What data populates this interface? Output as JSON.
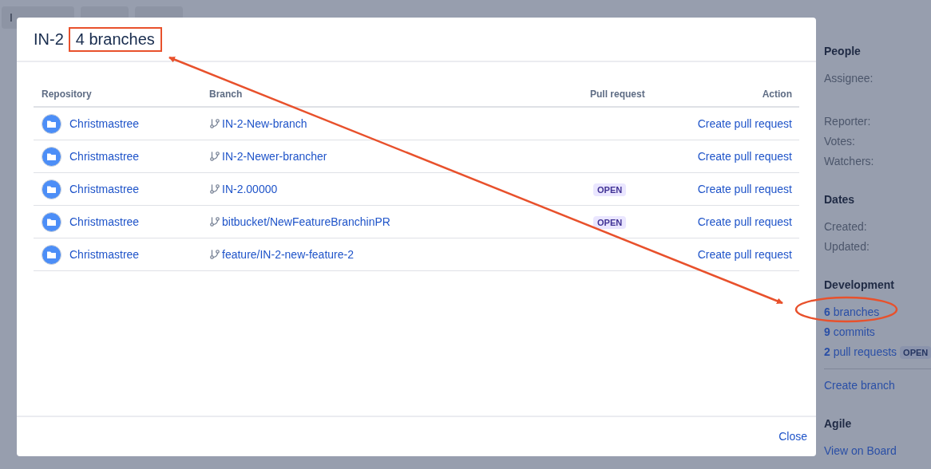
{
  "background": {
    "tabs": [
      {
        "kind": "labelled",
        "label": "I"
      },
      {
        "kind": "covered"
      },
      {
        "kind": "covered"
      }
    ],
    "sidebar": [
      {
        "title": "People",
        "items": [
          {
            "kind": "label",
            "text": "Assignee:"
          },
          {
            "kind": "spacer"
          },
          {
            "kind": "label",
            "text": "Reporter:"
          },
          {
            "kind": "label",
            "text": "Votes:"
          },
          {
            "kind": "label",
            "text": "Watchers:"
          }
        ]
      },
      {
        "title": "Dates",
        "items": [
          {
            "kind": "label",
            "text": "Created:"
          },
          {
            "kind": "label",
            "text": "Updated:"
          }
        ]
      },
      {
        "title": "Development",
        "items": [
          {
            "kind": "link",
            "text": "**6** branches"
          },
          {
            "kind": "link",
            "text": "**9** commits"
          },
          {
            "kind": "link",
            "text": "**2** pull requests",
            "badge": "OPEN"
          },
          {
            "kind": "divider"
          },
          {
            "kind": "link",
            "text": "Create branch"
          }
        ]
      },
      {
        "title": "Agile",
        "items": [
          {
            "kind": "link",
            "text": "View on Board"
          }
        ]
      }
    ]
  },
  "dialog": {
    "issue_key": "IN-2",
    "title": "4 branches",
    "columns": [
      "Repository",
      "Branch",
      "Pull request",
      "Action"
    ],
    "rows": [
      {
        "repository": "Christmastree",
        "branch": "IN-2-New-branch",
        "action": "Create pull request"
      },
      {
        "repository": "Christmastree",
        "branch": "IN-2-Newer-brancher",
        "action": "Create pull request"
      },
      {
        "repository": "Christmastree",
        "branch": "IN-2.00000",
        "pull_request": "OPEN",
        "action": "Create pull request"
      },
      {
        "repository": "Christmastree",
        "branch": "bitbucket/NewFeatureBranchinPR",
        "pull_request": "OPEN",
        "action": "Create pull request"
      },
      {
        "repository": "Christmastree",
        "branch": "feature/IN-2-new-feature-2",
        "action": "Create pull request"
      }
    ],
    "close": "Close"
  }
}
